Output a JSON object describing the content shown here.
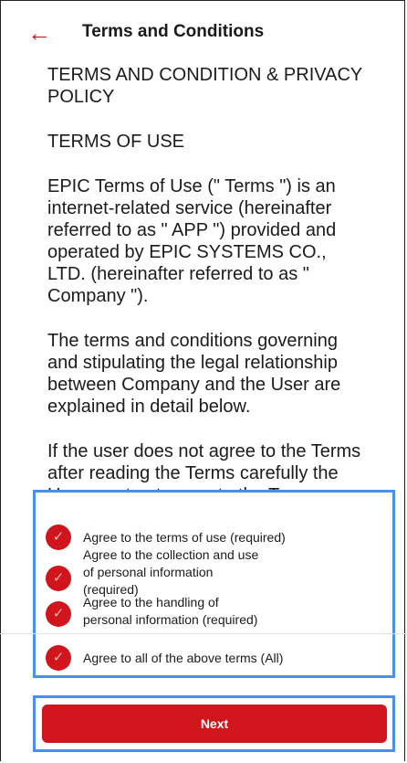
{
  "header": {
    "back_icon": "arrow-left-icon",
    "title": "Terms and Conditions"
  },
  "terms": {
    "paragraphs": [
      "TERMS AND CONDITION & PRIVACY POLICY",
      "TERMS OF USE",
      "EPIC Terms of Use (\" Terms \") is an internet-related service (hereinafter referred to as \" APP \") provided and operated by EPIC SYSTEMS CO., LTD. (hereinafter referred to as \" Company \").",
      "The terms and conditions governing and stipulating the legal relationship between Company and the User are explained in detail below.",
      "If the user does not agree to the Terms after reading the Terms carefully the User must not agree to the Terms, register or access the APP or use it."
    ]
  },
  "consents": [
    {
      "label": "Agree to the terms of use (required)",
      "checked": true
    },
    {
      "label": "Agree to the collection and use of personal information (required)",
      "checked": true
    },
    {
      "label": "Agree to the handling of personal information (required)",
      "checked": true
    },
    {
      "label": "Agree to all of the above terms (All)",
      "checked": true
    }
  ],
  "check_icon": "checkmark-icon",
  "next_label": "Next",
  "colors": {
    "accent": "#d0161c",
    "highlight": "#4a8fe8"
  }
}
